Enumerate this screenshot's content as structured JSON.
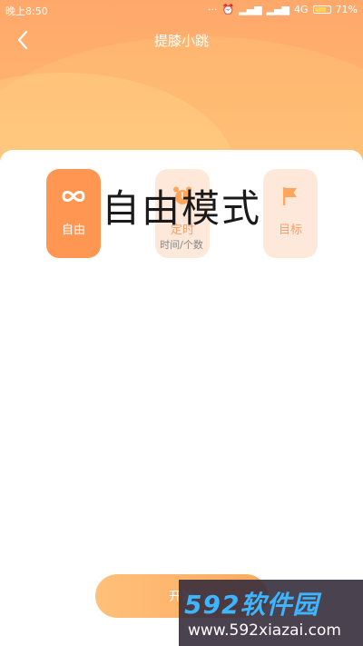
{
  "status_bar": {
    "time": "晚上8:50",
    "network": "4G",
    "battery": "71%"
  },
  "header": {
    "title": "提膝小跳"
  },
  "modes": [
    {
      "label": "自由",
      "icon": "infinity-icon",
      "active": true
    },
    {
      "label": "定时",
      "icon": "alarm-clock-icon",
      "active": false
    },
    {
      "label": "目标",
      "icon": "flag-icon",
      "active": false
    }
  ],
  "mode_display": {
    "title": "自由模式",
    "subtitle": "时间/个数"
  },
  "start_button": {
    "label": "开始"
  },
  "watermark": {
    "logo": "592软件园",
    "url": "www.592xiazai.com"
  },
  "colors": {
    "accent": "#ff9651",
    "inactive_bg": "#fde8da",
    "inactive_text": "#ff9f66",
    "header_gradient_top": "#ffa86b",
    "header_gradient_bottom": "#ffc27a"
  }
}
